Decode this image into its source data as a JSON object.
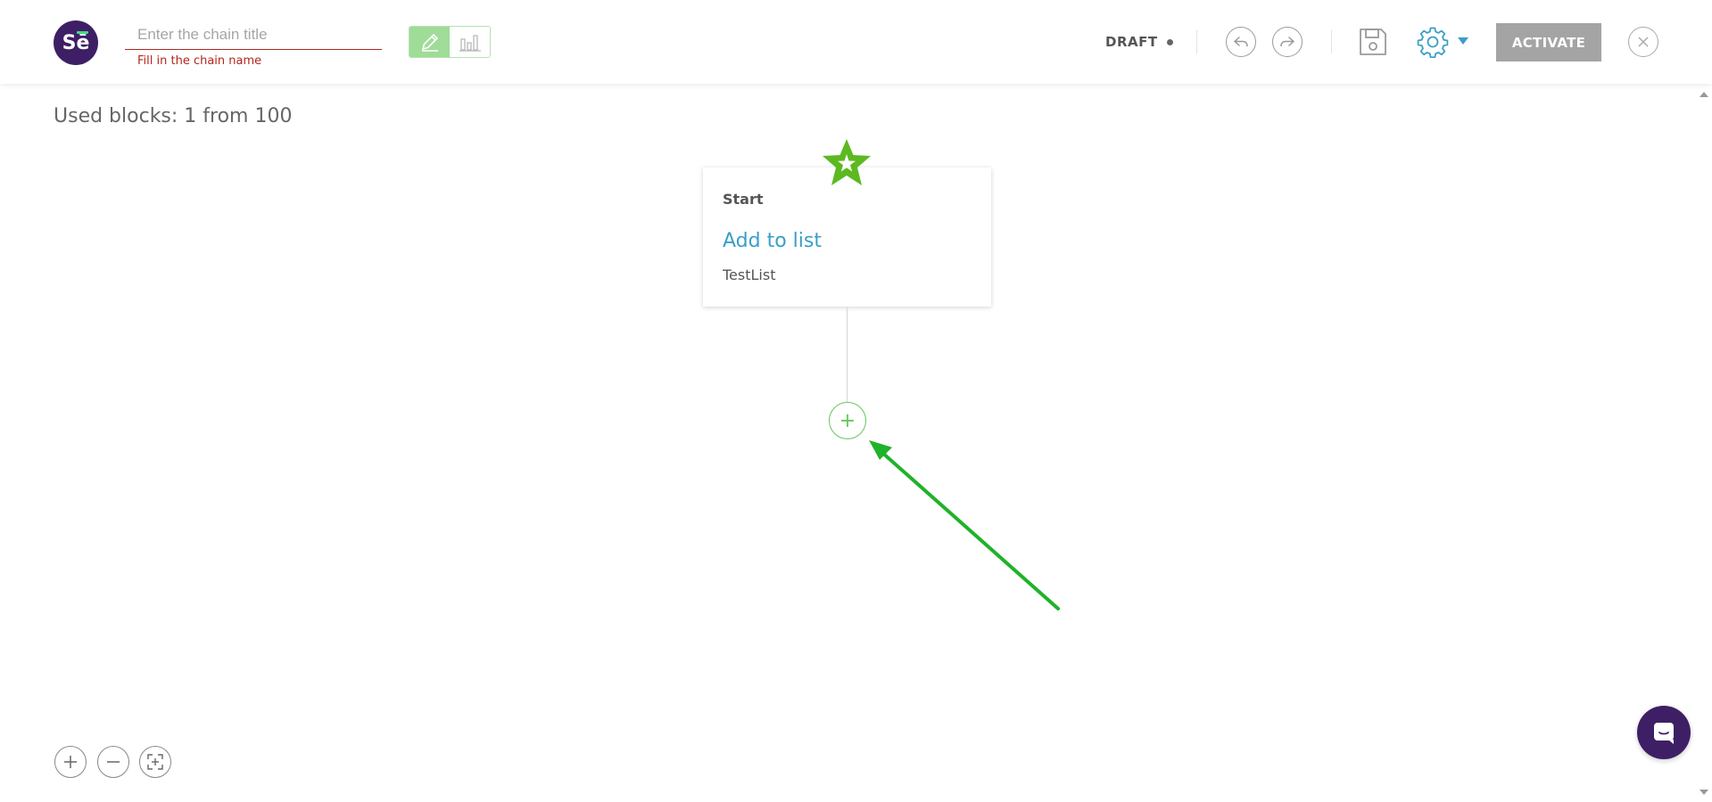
{
  "app": {
    "logo_text_s": "S",
    "logo_text_e": "ē",
    "brand_color": "#3e1f66",
    "accent_color": "#3a9ec8",
    "success_color": "#63c75a"
  },
  "header": {
    "title_placeholder": "Enter the chain title",
    "title_value": "",
    "title_error": "Fill in the chain name",
    "status": "DRAFT",
    "activate_label": "ACTIVATE",
    "mode_edit_icon": "pencil-icon",
    "mode_stats_icon": "bar-chart-icon",
    "undo_icon": "undo-icon",
    "redo_icon": "redo-icon",
    "save_icon": "floppy-disk-icon",
    "settings_icon": "gear-icon",
    "close_icon": "close-icon"
  },
  "canvas": {
    "used_blocks_label": "Used blocks: 1 from 100",
    "start_block": {
      "kind": "Start",
      "action": "Add to list",
      "parameter": "TestList",
      "badge_icon": "star-icon"
    },
    "add_node_label": "+"
  },
  "zoom": {
    "zoom_in_icon": "zoom-in-icon",
    "zoom_out_icon": "zoom-out-icon",
    "fit_icon": "fit-to-screen-icon"
  },
  "chat": {
    "icon": "chat-icon"
  }
}
